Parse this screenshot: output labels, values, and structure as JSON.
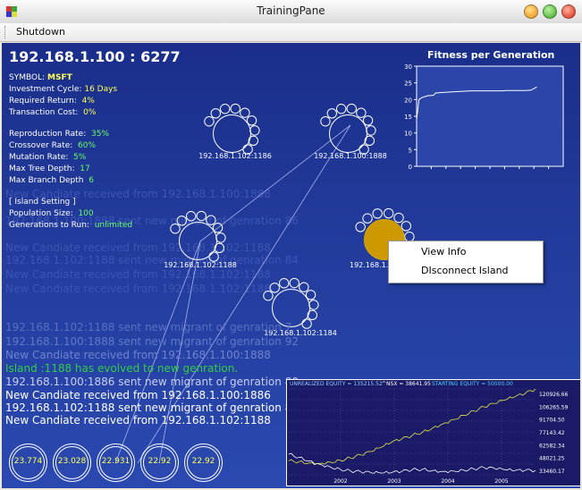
{
  "window": {
    "title": "TrainingPane"
  },
  "menu": {
    "shutdown": "Shutdown"
  },
  "header": {
    "address": "192.168.1.100 : 6277"
  },
  "params": {
    "symbol_label": "SYMBOL:",
    "symbol_value": "MSFT",
    "cycle_label": "Investment Cycle:",
    "cycle_value": "16 Days",
    "return_label": "Required Return:",
    "return_value": "4%",
    "cost_label": "Transaction Cost:",
    "cost_value": "0%",
    "repro_label": "Reproduction Rate:",
    "repro_value": "35%",
    "cross_label": "Crossover Rate:",
    "cross_value": "60%",
    "mut_label": "Mutation Rate:",
    "mut_value": "5%",
    "depth_label": "Max Tree Depth:",
    "depth_value": "17",
    "branch_label": "Max Branch Depth",
    "branch_value": "6",
    "island_header": "[ Island Setting ]",
    "pop_label": "Population Size:",
    "pop_value": "100",
    "gens_label": "Generations to Run:",
    "gens_value": "unlimited"
  },
  "nodes": [
    {
      "label": "192.168.1.102:1186"
    },
    {
      "label": "192.168.1.100:1888"
    },
    {
      "label": "192.168.1.102:1188"
    },
    {
      "label": "192.168.1.1"
    },
    {
      "label": "192.168.1.102:1184"
    }
  ],
  "context_menu": {
    "view_info": "View Info",
    "disconnect": "DIsconnect Island"
  },
  "log": [
    {
      "text": "192.168.1.102:1188 sent new migrant of genration 7",
      "color": "#5a6fc0"
    },
    {
      "text": "192.168.1.100:1888 sent new migrant of genration 92",
      "color": "#6279c8"
    },
    {
      "text": "New Candiate received from 192.168.1.100:1888",
      "color": "#7083cf"
    },
    {
      "text": "Island :1188 has evolved to new genration.",
      "color": "#33cc44"
    },
    {
      "text": "192.168.1.100:1886 sent new migrant of genration 80",
      "color": "#c8cff0"
    },
    {
      "text": "New Candiate received from 192.168.1.100:1886",
      "color": "#ffffff"
    },
    {
      "text": "192.168.1.102:1188 sent new migrant of genration 83",
      "color": "#ffffff"
    },
    {
      "text": "New Candiate received from 192.168.1.102:1188",
      "color": "#ffffff"
    }
  ],
  "ghost_log": [
    "New Candiate received from 192.168.1.100:1888",
    "192.168.1.100:1888 sent new migrant of genration 86",
    "New Candiate received from 192.168.1.102:1188",
    "192.168.1.102:1188 sent new migrant of genration 84",
    "New Candiate received from 192.168.1.102:1188",
    "New Candiate received from 192.168.1.102:1188"
  ],
  "fitness": {
    "title": "Fitness per Generation",
    "scores": [
      "23.774",
      "23.028",
      "22.931",
      "22.92",
      "22.92"
    ]
  },
  "equity": {
    "legend_unrealized": "UNREALIZED EQUITY = 135215.52",
    "legend_nsx": "^NSX = 38641.95",
    "legend_starting": "STARTING EQUITY = 50000.00",
    "y_ticks": [
      "120926.66",
      "106265.59",
      "91704.50",
      "77143.42",
      "62582.34",
      "48021.25",
      "33460.17"
    ],
    "x_ticks": [
      "2002",
      "2003",
      "2004",
      "2005"
    ]
  },
  "chart_data": [
    {
      "type": "line",
      "title": "Fitness per Generation",
      "ylim": [
        0,
        30
      ],
      "y_ticks": [
        0,
        5,
        10,
        15,
        20,
        25,
        30
      ],
      "x": [
        0,
        2,
        4,
        6,
        8,
        10,
        12,
        14,
        16,
        18,
        20,
        25,
        30,
        35,
        40,
        45,
        50,
        55,
        60,
        65,
        70,
        75,
        80,
        85,
        90,
        95,
        100
      ],
      "values": [
        14,
        20,
        20.5,
        20.8,
        21,
        21.2,
        21.2,
        21.3,
        22,
        22,
        22.1,
        22.2,
        22.3,
        22.4,
        22.5,
        22.6,
        22.6,
        22.6,
        22.6,
        22.6,
        22.6,
        22.7,
        22.7,
        22.7,
        22.7,
        22.8,
        23.8
      ],
      "color": "#ffffff"
    },
    {
      "type": "line",
      "ylim": [
        33460.17,
        135215.52
      ],
      "x_ticks": [
        "2002",
        "2003",
        "2004",
        "2005"
      ],
      "series": [
        {
          "name": "UNREALIZED EQUITY",
          "color": "#e8e84a",
          "values": [
            50000,
            49000,
            47500,
            47000,
            48500,
            50500,
            53500,
            57000,
            61000,
            66000,
            72000,
            76000,
            80000,
            84000,
            89000,
            94000,
            99000,
            104000,
            109000,
            114000,
            118000,
            122000,
            126000,
            130000,
            135215
          ]
        },
        {
          "name": "^NSX",
          "color": "#ffffff",
          "values": [
            58000,
            54000,
            50000,
            46000,
            43000,
            40000,
            38000,
            37000,
            36000,
            35500,
            36000,
            37500,
            39500,
            40000,
            38500,
            37500,
            38000,
            39000,
            40500,
            42000,
            41000,
            39500,
            38500,
            38700,
            38641
          ]
        }
      ]
    }
  ]
}
